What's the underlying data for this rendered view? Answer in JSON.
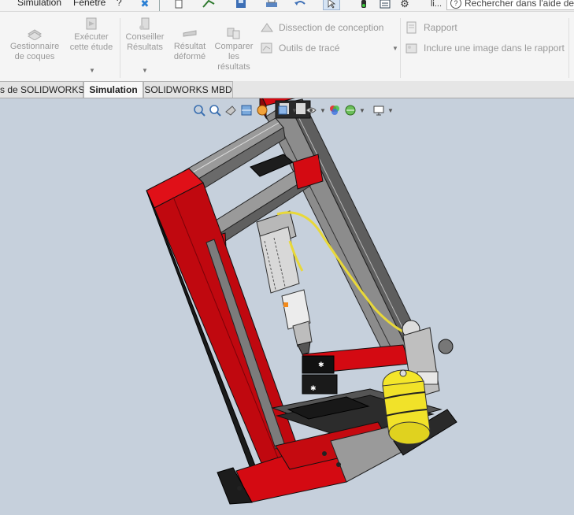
{
  "menu": {
    "items": [
      "Simulation",
      "Fenêtre",
      "?"
    ]
  },
  "help_search": {
    "placeholder": "Rechercher dans l'aide de"
  },
  "toolbar": {
    "truncated_label": "li..."
  },
  "ribbon": {
    "shell_manager": "Gestionnaire de coques",
    "run_study": "Exécuter cette étude",
    "results_advisor": "Conseiller Résultats",
    "deformed_result": "Résultat déformé",
    "compare_results": "Comparer les résultats",
    "design_insight": "Dissection de conception",
    "plot_tools": "Outils de tracé",
    "report": "Rapport",
    "include_image": "Inclure une image dans le rapport"
  },
  "tabs": [
    {
      "label": "ts de SOLIDWORKS",
      "active": false
    },
    {
      "label": "Simulation",
      "active": true
    },
    {
      "label": "SOLIDWORKS MBD",
      "active": false
    }
  ],
  "colors": {
    "viewport_bg": "#c6d0dc",
    "frame_red": "#d40a12",
    "frame_dark": "#1a1a1a",
    "rail_gray": "#8c8c8c",
    "tank_yellow": "#f4e62a",
    "hose_yellow": "#e8d83a"
  }
}
